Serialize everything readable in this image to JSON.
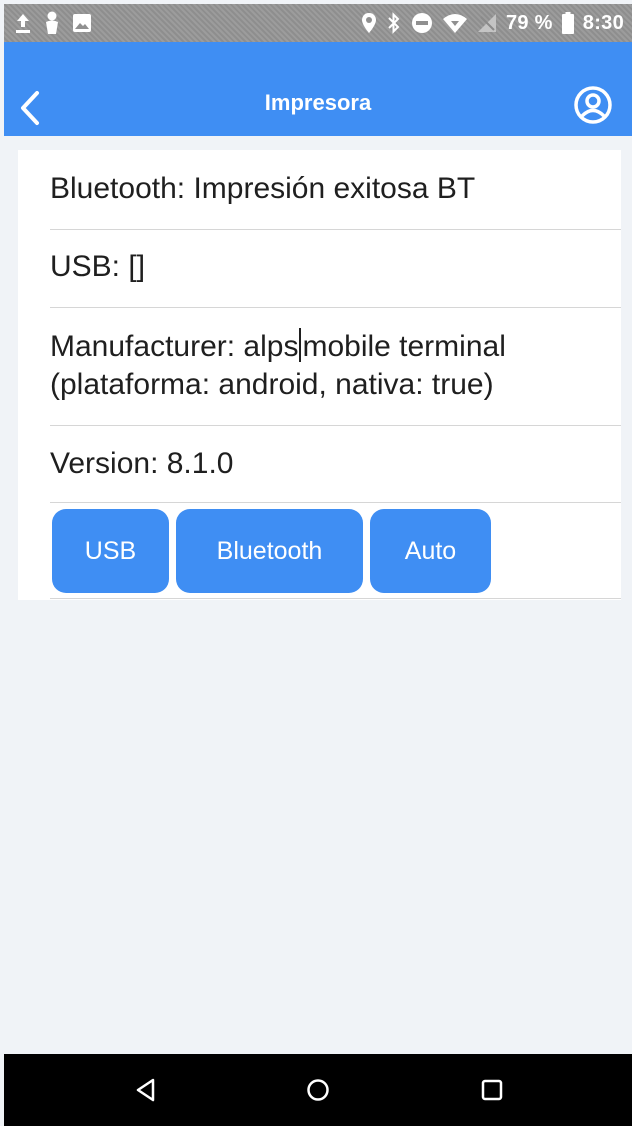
{
  "status_bar": {
    "battery_percent": "79 %",
    "time": "8:30",
    "icons_left": [
      "upload-icon",
      "person-icon",
      "image-icon"
    ],
    "icons_right": [
      "location-icon",
      "bluetooth-icon",
      "do-not-disturb-icon",
      "wifi-icon",
      "no-signal-icon",
      "battery-icon"
    ]
  },
  "header": {
    "title": "Impresora",
    "back_icon": "chevron-left-icon",
    "profile_icon": "user-circle-icon",
    "color": "#3f8ef3"
  },
  "info": {
    "bluetooth": "Bluetooth: Impresión exitosa BT",
    "usb": "USB: []",
    "manufacturer_part1": "Manufacturer: alps",
    "manufacturer_part2": "mobile terminal",
    "manufacturer_line2": "(plataforma: android, nativa: true)",
    "version": "Version: 8.1.0"
  },
  "buttons": {
    "usb": "USB",
    "bluetooth": "Bluetooth",
    "auto": "Auto"
  },
  "nav_bar": {
    "back": "triangle-back-icon",
    "home": "circle-home-icon",
    "recents": "square-recents-icon"
  }
}
